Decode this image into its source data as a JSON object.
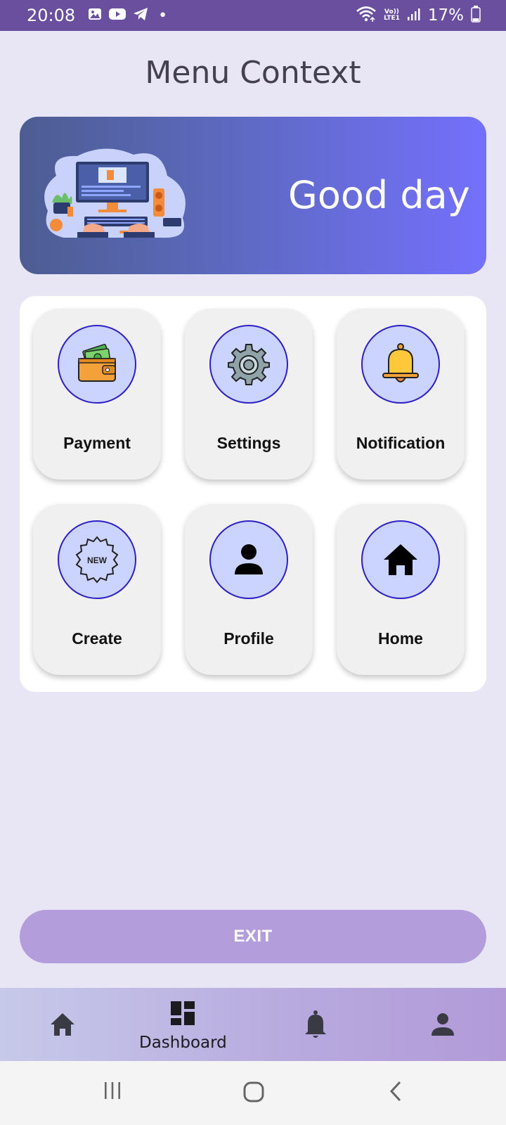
{
  "status_bar": {
    "time": "20:08",
    "battery": "17%",
    "dot": "•",
    "network_top": "Vo))",
    "network_bottom": "LTE1"
  },
  "page_title": "Menu Context",
  "banner": {
    "greeting": "Good day"
  },
  "menu": {
    "items": [
      {
        "label": "Payment",
        "icon": "wallet-icon"
      },
      {
        "label": "Settings",
        "icon": "gear-icon"
      },
      {
        "label": "Notification",
        "icon": "bell-icon"
      },
      {
        "label": "Create",
        "icon": "new-badge-icon",
        "badge_text": "NEW"
      },
      {
        "label": "Profile",
        "icon": "person-icon"
      },
      {
        "label": "Home",
        "icon": "home-icon"
      }
    ]
  },
  "exit_button": {
    "label": "EXIT"
  },
  "bottom_nav": {
    "items": [
      {
        "icon": "home-icon",
        "label": ""
      },
      {
        "icon": "dashboard-icon",
        "label": "Dashboard",
        "selected": true
      },
      {
        "icon": "bell-icon",
        "label": ""
      },
      {
        "icon": "person-icon",
        "label": ""
      }
    ]
  },
  "colors": {
    "status_bar": "#6a4f9e",
    "background": "#e8e5f4",
    "icon_circle_fill": "#cbd4ff",
    "icon_circle_border": "#2e20c4",
    "exit_button": "#b39ddb"
  }
}
